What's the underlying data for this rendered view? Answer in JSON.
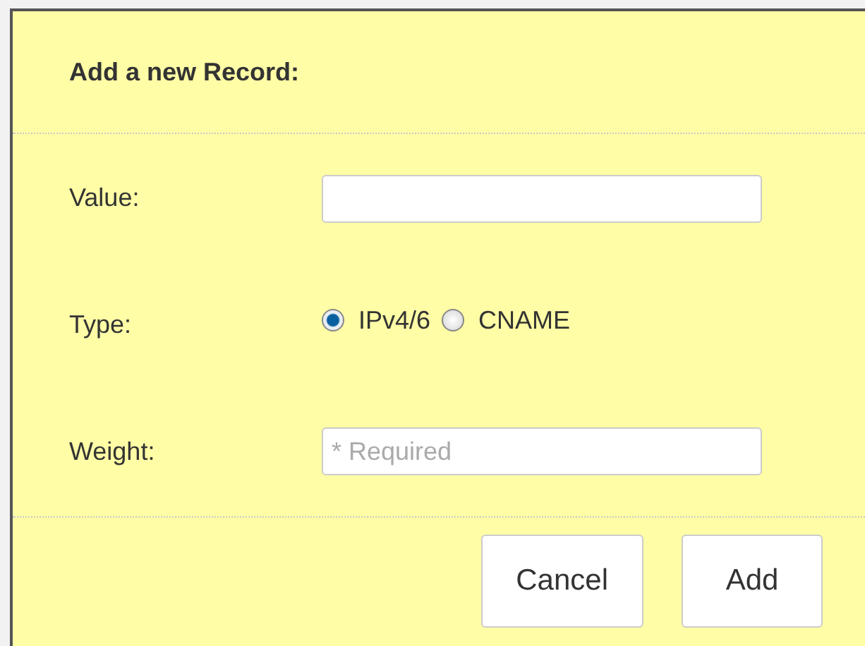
{
  "title": "Add a new Record:",
  "fields": [
    {
      "kind": "text",
      "label": "Value:"
    },
    {
      "kind": "radio",
      "label": "Type:",
      "options": [
        {
          "label": "IPv4/6",
          "selected": true
        },
        {
          "label": "CNAME",
          "selected": false
        }
      ]
    },
    {
      "kind": "text",
      "label": "Weight:",
      "placeholder": "* Required"
    }
  ],
  "buttons": [
    "Cancel",
    "Add"
  ]
}
